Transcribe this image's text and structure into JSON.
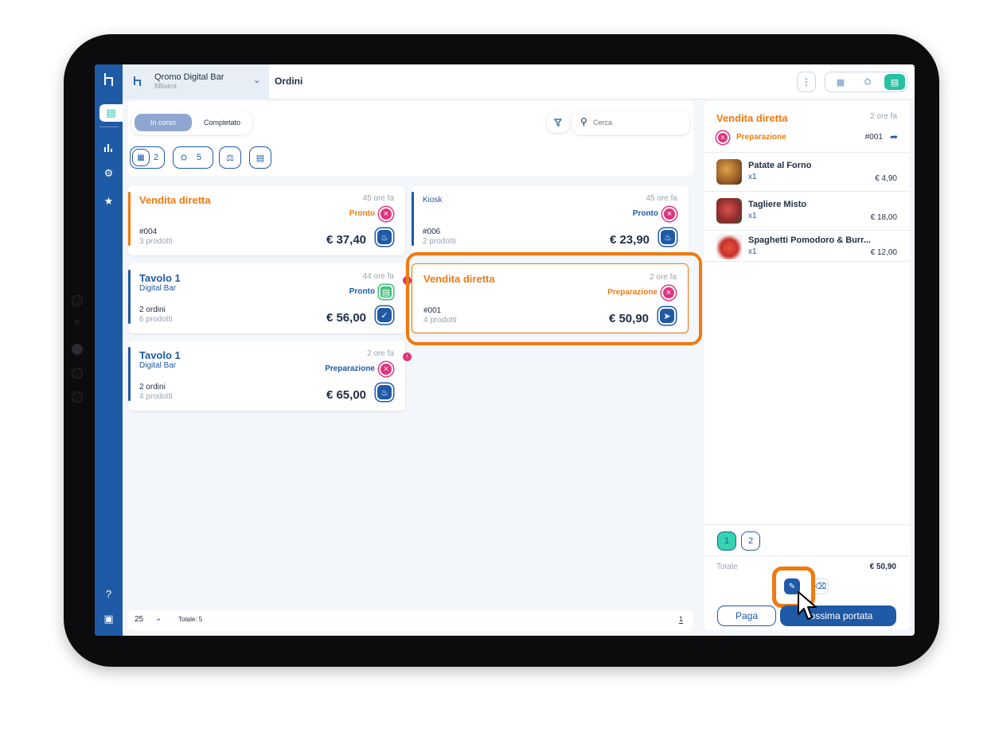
{
  "app": {
    "venue_name": "Qromo Digital Bar",
    "venue_sub": "BBistrot",
    "page_title": "Ordini"
  },
  "sidebar": {
    "items": [
      {
        "icon": "orders-icon",
        "active": true
      },
      {
        "icon": "stats-icon",
        "active": false
      },
      {
        "icon": "settings-icon",
        "active": false
      },
      {
        "icon": "kitchen-icon",
        "active": false
      },
      {
        "icon": "help-icon",
        "active": false
      },
      {
        "icon": "monitor-icon",
        "active": false
      }
    ]
  },
  "toolbar": {
    "tab_active": "In corso",
    "tab_other": "Completato",
    "search_placeholder": "Cerca",
    "chips": [
      {
        "icon": "menu-book-icon",
        "count": "2"
      },
      {
        "icon": "table-icon",
        "count": "5"
      },
      {
        "icon": "delivery-icon",
        "count": ""
      },
      {
        "icon": "takeaway-icon",
        "count": ""
      }
    ]
  },
  "orders": [
    {
      "title": "Vendita diretta",
      "sub": "",
      "time": "45 ore fa",
      "status": "Pronto",
      "line1": "#004",
      "line2": "3 prodotti",
      "price": "€ 37,40",
      "title_color": "#f07a10",
      "status_color": "#f07a10",
      "bar_color": "#f07a10",
      "x_style": "pink"
    },
    {
      "title": "",
      "sub": "Kiosk",
      "time": "45 ore fa",
      "status": "Pronto",
      "line1": "#006",
      "line2": "2 prodotti",
      "price": "€ 23,90",
      "title_color": "#1f5aa6",
      "status_color": "#1f5aa6",
      "bar_color": "#1f5aa6",
      "x_style": "pink"
    },
    {
      "title": "Tavolo 1",
      "sub": "Digital Bar",
      "time": "44 ore fa",
      "status": "Pronto",
      "line1": "2 ordini",
      "line2": "6 prodotti",
      "price": "€ 56,00",
      "title_color": "#1f5aa6",
      "status_color": "#1f5aa6",
      "bar_color": "#1f5aa6",
      "x_style": "green"
    },
    {
      "title": "Vendita diretta",
      "sub": "",
      "time": "2 ore fa",
      "status": "Preparazione",
      "line1": "#001",
      "line2": "4 prodotti",
      "price": "€ 50,90",
      "title_color": "#f07a10",
      "status_color": "#f07a10",
      "bar_color": "#f07a10",
      "x_style": "pink"
    },
    {
      "title": "Tavolo 1",
      "sub": "Digital Bar",
      "time": "2 ore fa",
      "status": "Preparazione",
      "line1": "2 ordini",
      "line2": "4 prodotti",
      "price": "€ 65,00",
      "title_color": "#1f5aa6",
      "status_color": "#1f5aa6",
      "bar_color": "#1f5aa6",
      "x_style": "pink"
    }
  ],
  "footer": {
    "per_page": "25",
    "total": "Totale: 5",
    "page": "1"
  },
  "detail": {
    "title": "Vendita diretta",
    "time": "2 ore fa",
    "status": "Preparazione",
    "number": "#001",
    "items": [
      {
        "name": "Patate al Forno",
        "qty": "x1",
        "price": "€ 4,90"
      },
      {
        "name": "Tagliere Misto",
        "qty": "x1",
        "price": "€ 18,00"
      },
      {
        "name": "Spaghetti Pomodoro & Burr...",
        "qty": "x1",
        "price": "€ 12,00"
      }
    ],
    "tabs": [
      "1",
      "2"
    ],
    "total_label": "Totale",
    "total": "€ 50,90",
    "pay_label": "Paga",
    "next_label": "ossima portata"
  },
  "colors": {
    "primary": "#1f5aa6",
    "accent": "#26c0a2",
    "orange": "#f07a10",
    "pink": "#e0357c",
    "green": "#3fc27a"
  }
}
